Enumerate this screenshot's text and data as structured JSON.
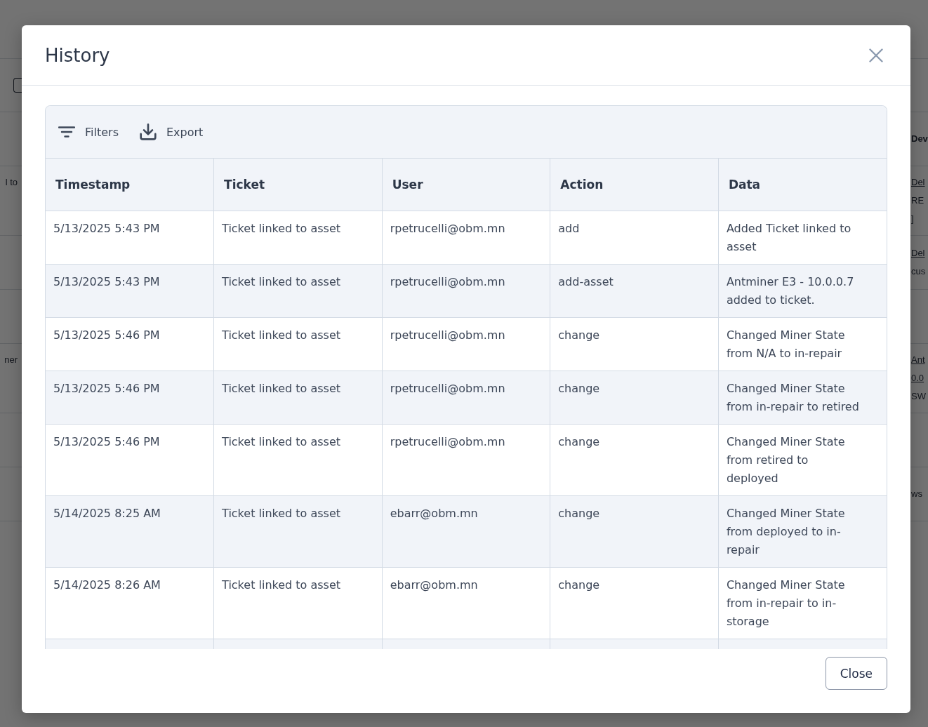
{
  "background_page": {
    "select_all_checkbox": {
      "checked": false
    },
    "rows": [
      {
        "right": [
          {
            "text": "Dev",
            "kind": "heading"
          }
        ]
      },
      {
        "left": "l to",
        "right": [
          {
            "text": "Del",
            "kind": "link"
          },
          {
            "text": "RE",
            "kind": "text"
          },
          {
            "text": "]",
            "kind": "text"
          }
        ]
      },
      {
        "right": [
          {
            "text": "Del",
            "kind": "link"
          },
          {
            "text": "cus",
            "kind": "text"
          }
        ]
      },
      {},
      {
        "left": "ner",
        "right": [
          {
            "text": "Ant",
            "kind": "link"
          },
          {
            "text": "0.0",
            "kind": "link"
          },
          {
            "text": "SW",
            "kind": "text"
          }
        ]
      },
      {},
      {
        "right": [
          {
            "text": "ws",
            "kind": "text"
          }
        ]
      }
    ]
  },
  "dialog": {
    "title": "History",
    "toolbar": [
      {
        "label": "Filters",
        "kind": "filter"
      },
      {
        "label": "Export",
        "kind": "export"
      }
    ],
    "table": {
      "columns": [
        "Timestamp",
        "Ticket",
        "User",
        "Action",
        "Data"
      ],
      "rows": [
        [
          "5/13/2025 5:43 PM",
          "Ticket linked to asset",
          "rpetrucelli@obm.mn",
          "add",
          "Added Ticket linked to asset"
        ],
        [
          "5/13/2025 5:43 PM",
          "Ticket linked to asset",
          "rpetrucelli@obm.mn",
          "add-asset",
          "Antminer E3 - 10.0.0.7 added to ticket."
        ],
        [
          "5/13/2025 5:46 PM",
          "Ticket linked to asset",
          "rpetrucelli@obm.mn",
          "change",
          "Changed Miner State from N/A to in-repair"
        ],
        [
          "5/13/2025 5:46 PM",
          "Ticket linked to asset",
          "rpetrucelli@obm.mn",
          "change",
          "Changed Miner State from in-repair to retired"
        ],
        [
          "5/13/2025 5:46 PM",
          "Ticket linked to asset",
          "rpetrucelli@obm.mn",
          "change",
          "Changed Miner State from retired to deployed"
        ],
        [
          "5/14/2025 8:25 AM",
          "Ticket linked to asset",
          "ebarr@obm.mn",
          "change",
          "Changed Miner State from deployed to in-repair"
        ],
        [
          "5/14/2025 8:26 AM",
          "Ticket linked to asset",
          "ebarr@obm.mn",
          "change",
          "Changed Miner State from in-repair to in-storage"
        ]
      ]
    },
    "buttons": [
      {
        "label": "Close"
      }
    ]
  }
}
